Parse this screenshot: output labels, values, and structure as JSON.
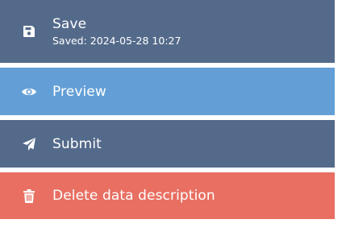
{
  "actions": {
    "save": {
      "label": "Save",
      "status": "Saved: 2024-05-28 10:27",
      "icon": "floppy-disk-icon",
      "color": "#546a8a"
    },
    "preview": {
      "label": "Preview",
      "icon": "eye-icon",
      "color": "#639fd6"
    },
    "submit": {
      "label": "Submit",
      "icon": "paper-plane-icon",
      "color": "#546a8a"
    },
    "delete": {
      "label": "Delete data description",
      "icon": "trash-icon",
      "color": "#e86f62"
    }
  }
}
